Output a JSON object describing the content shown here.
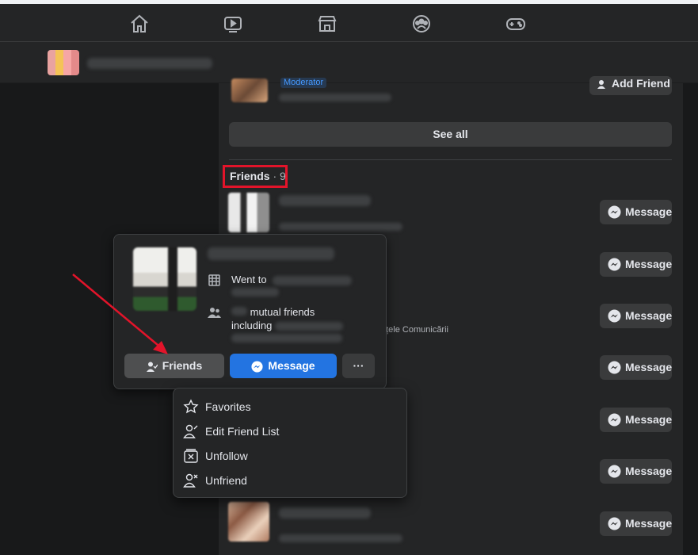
{
  "nav": {
    "icons": [
      "home-icon",
      "watch-icon",
      "marketplace-icon",
      "groups-icon",
      "gaming-icon"
    ]
  },
  "members": {
    "moderator_badge": "Moderator",
    "add_friend_label": "Add Friend",
    "see_all_label": "See all"
  },
  "friends_section": {
    "title": "Friends",
    "count": " · 9",
    "message_label": "Message",
    "partial_text": "nțele Comunicării"
  },
  "hovercard": {
    "went_to_label": "Went to",
    "mutual_label": "mutual friends",
    "including_label": "including",
    "friends_button": "Friends",
    "message_button": "Message",
    "more_button": "···"
  },
  "friend_menu": {
    "items": [
      "Favorites",
      "Edit Friend List",
      "Unfollow",
      "Unfriend"
    ]
  },
  "colors": {
    "accent_blue": "#2374e1",
    "highlight_red": "#e2142a"
  }
}
